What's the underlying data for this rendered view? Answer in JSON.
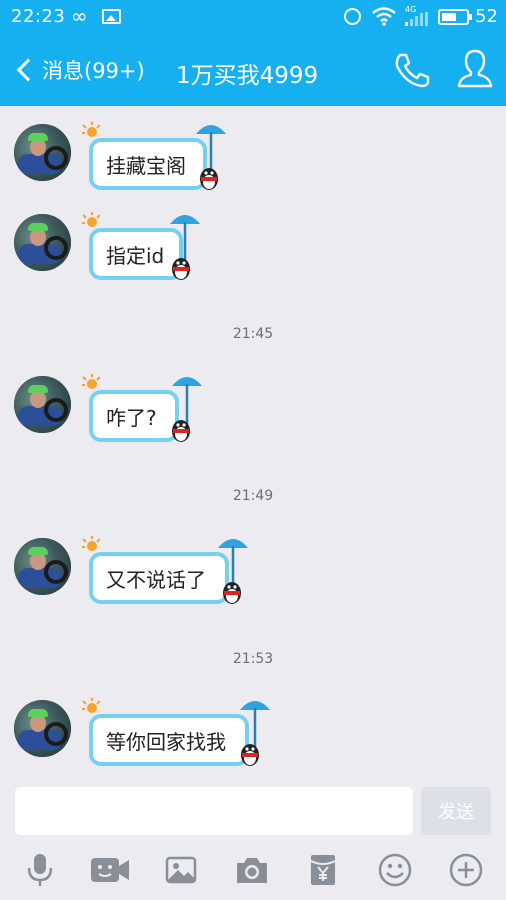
{
  "status_bar": {
    "time": "22:23",
    "infinity_symbol": "∞",
    "network": "4G",
    "battery": "52"
  },
  "header": {
    "back_label": "消息(99+)",
    "title": "1万买我4999"
  },
  "messages": [
    {
      "text": "挂藏宝阁"
    },
    {
      "text": "指定id"
    },
    {
      "timestamp": "21:45"
    },
    {
      "text": "咋了?"
    },
    {
      "timestamp": "21:49"
    },
    {
      "text": "又不说话了"
    },
    {
      "timestamp": "21:53"
    },
    {
      "text": "等你回家找我"
    }
  ],
  "composer": {
    "input_value": "",
    "send_label": "发送"
  },
  "toolbar": {
    "icons": [
      "microphone-icon",
      "video-call-icon",
      "image-icon",
      "camera-icon",
      "red-packet-icon",
      "emoji-icon",
      "plus-icon"
    ]
  },
  "colors": {
    "accent": "#16b0f0",
    "bubble_border": "#75d1ee",
    "background": "#ebebf0"
  }
}
